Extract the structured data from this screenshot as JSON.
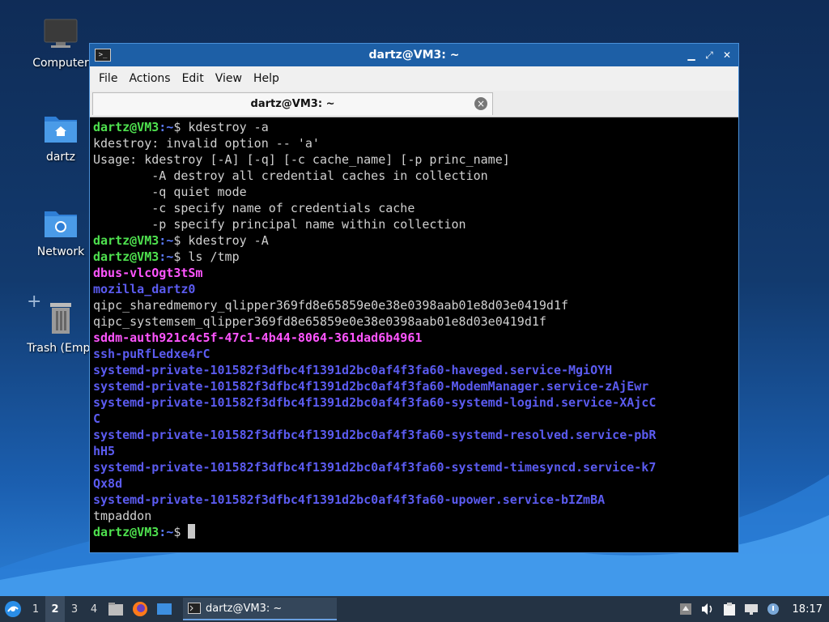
{
  "desktop": {
    "icons": [
      {
        "label": "Computer"
      },
      {
        "label": "dartz"
      },
      {
        "label": "Network"
      },
      {
        "label": "Trash (Empt"
      }
    ]
  },
  "window": {
    "title": "dartz@VM3: ~",
    "menu": [
      "File",
      "Actions",
      "Edit",
      "View",
      "Help"
    ],
    "tab_title": "dartz@VM3: ~"
  },
  "terminal": {
    "prompt_user": "dartz@VM3",
    "prompt_path": ":~",
    "prompt_sym": "$ ",
    "lines": [
      {
        "kind": "prompt",
        "text": "kdestroy -a"
      },
      {
        "kind": "out",
        "text": "kdestroy: invalid option -- 'a'"
      },
      {
        "kind": "out",
        "text": "Usage: kdestroy [-A] [-q] [-c cache_name] [-p princ_name]"
      },
      {
        "kind": "out",
        "text": "        -A destroy all credential caches in collection"
      },
      {
        "kind": "out",
        "text": "        -q quiet mode"
      },
      {
        "kind": "out",
        "text": "        -c specify name of credentials cache"
      },
      {
        "kind": "out",
        "text": "        -p specify principal name within collection"
      },
      {
        "kind": "prompt",
        "text": "kdestroy -A"
      },
      {
        "kind": "prompt",
        "text": "ls /tmp"
      },
      {
        "kind": "magenta",
        "text": "dbus-vlcOgt3tSm"
      },
      {
        "kind": "blue",
        "text": "mozilla_dartz0"
      },
      {
        "kind": "out",
        "text": "qipc_sharedmemory_qlipper369fd8e65859e0e38e0398aab01e8d03e0419d1f"
      },
      {
        "kind": "out",
        "text": "qipc_systemsem_qlipper369fd8e65859e0e38e0398aab01e8d03e0419d1f"
      },
      {
        "kind": "magenta",
        "text": "sddm-auth921c4c5f-47c1-4b44-8064-361dad6b4961"
      },
      {
        "kind": "blue",
        "text": "ssh-puRfLedxe4rC"
      },
      {
        "kind": "blue",
        "text": "systemd-private-101582f3dfbc4f1391d2bc0af4f3fa60-haveged.service-MgiOYH"
      },
      {
        "kind": "blue",
        "text": "systemd-private-101582f3dfbc4f1391d2bc0af4f3fa60-ModemManager.service-zAjEwr"
      },
      {
        "kind": "blue",
        "text": "systemd-private-101582f3dfbc4f1391d2bc0af4f3fa60-systemd-logind.service-XAjcC"
      },
      {
        "kind": "blue",
        "text": "C"
      },
      {
        "kind": "blue",
        "text": "systemd-private-101582f3dfbc4f1391d2bc0af4f3fa60-systemd-resolved.service-pbR"
      },
      {
        "kind": "blue",
        "text": "hH5"
      },
      {
        "kind": "blue",
        "text": "systemd-private-101582f3dfbc4f1391d2bc0af4f3fa60-systemd-timesyncd.service-k7"
      },
      {
        "kind": "blue",
        "text": "Qx8d"
      },
      {
        "kind": "blue",
        "text": "systemd-private-101582f3dfbc4f1391d2bc0af4f3fa60-upower.service-bIZmBA"
      },
      {
        "kind": "out",
        "text": "tmpaddon"
      },
      {
        "kind": "prompt",
        "text": ""
      }
    ],
    "colors": {
      "out": "#d0d0d0",
      "blue": "#5b5bf0",
      "magenta": "#ff55ff",
      "user": "#4ee04e",
      "path": "#5b7bff"
    }
  },
  "taskbar": {
    "workspaces": [
      "1",
      "2",
      "3",
      "4"
    ],
    "active_workspace": "2",
    "task_label": "dartz@VM3: ~",
    "clock": "18:17"
  }
}
